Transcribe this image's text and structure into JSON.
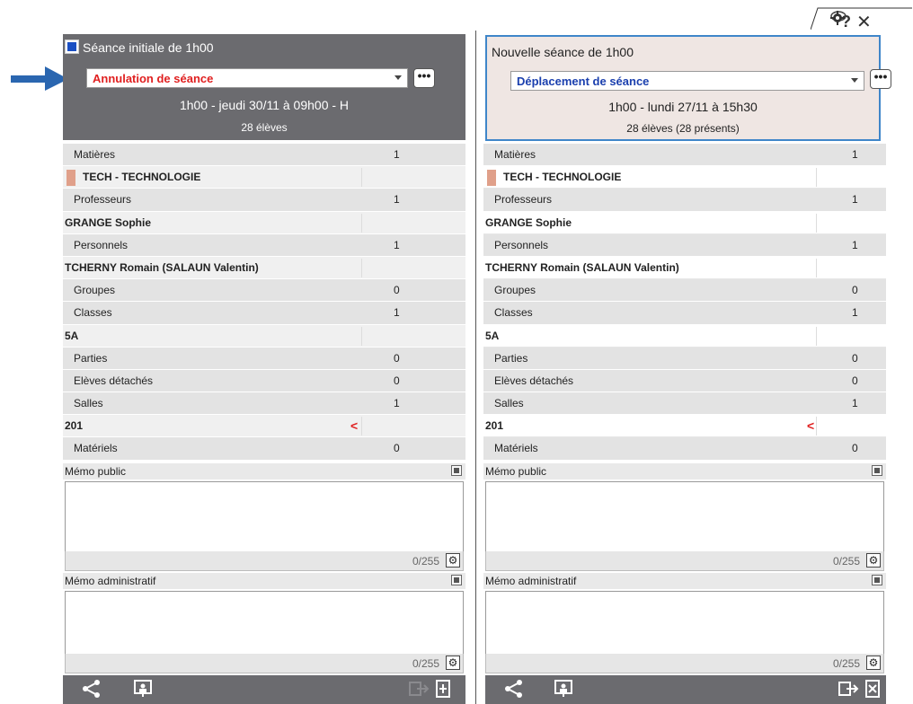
{
  "toolbar": {
    "icons": [
      "eye-icon",
      "gear-icon",
      "help-icon",
      "close-icon"
    ]
  },
  "left": {
    "title": "Séance initiale de 1h00",
    "action_value": "Annulation de séance",
    "more_label": "•••",
    "line1": "1h00  -  jeudi 30/11 à 09h00  -  H",
    "line2": "28 élèves",
    "rows": [
      {
        "type": "cat",
        "label": "Matières",
        "count": "1"
      },
      {
        "type": "item",
        "label": "TECH - TECHNOLOGIE",
        "swatch": true
      },
      {
        "type": "cat",
        "label": "Professeurs",
        "count": "1"
      },
      {
        "type": "item",
        "label": "GRANGE Sophie"
      },
      {
        "type": "cat",
        "label": "Personnels",
        "count": "1"
      },
      {
        "type": "item",
        "label": "TCHERNY Romain (SALAUN Valentin)"
      },
      {
        "type": "cat",
        "label": "Groupes",
        "count": "0"
      },
      {
        "type": "cat",
        "label": "Classes",
        "count": "1"
      },
      {
        "type": "item",
        "label": "5A"
      },
      {
        "type": "cat",
        "label": "Parties",
        "count": "0"
      },
      {
        "type": "cat",
        "label": "Elèves détachés",
        "count": "0"
      },
      {
        "type": "cat",
        "label": "Salles",
        "count": "1"
      },
      {
        "type": "item",
        "label": "201",
        "mark": "<"
      },
      {
        "type": "cat",
        "label": "Matériels",
        "count": "0"
      }
    ],
    "memo_public": {
      "label": "Mémo public",
      "counter": "0/255"
    },
    "memo_admin": {
      "label": "Mémo administratif",
      "counter": "0/255"
    }
  },
  "right": {
    "title": "Nouvelle séance de 1h00",
    "action_value": "Déplacement de séance",
    "more_label": "•••",
    "line1": "1h00  -  lundi 27/11 à 15h30",
    "line2": "28 élèves (28 présents)",
    "rows": [
      {
        "type": "cat",
        "label": "Matières",
        "count": "1"
      },
      {
        "type": "item",
        "label": "TECH - TECHNOLOGIE",
        "swatch": true
      },
      {
        "type": "cat",
        "label": "Professeurs",
        "count": "1"
      },
      {
        "type": "item",
        "label": "GRANGE Sophie"
      },
      {
        "type": "cat",
        "label": "Personnels",
        "count": "1"
      },
      {
        "type": "item",
        "label": "TCHERNY Romain (SALAUN Valentin)"
      },
      {
        "type": "cat",
        "label": "Groupes",
        "count": "0"
      },
      {
        "type": "cat",
        "label": "Classes",
        "count": "1"
      },
      {
        "type": "item",
        "label": "5A"
      },
      {
        "type": "cat",
        "label": "Parties",
        "count": "0"
      },
      {
        "type": "cat",
        "label": "Elèves détachés",
        "count": "0"
      },
      {
        "type": "cat",
        "label": "Salles",
        "count": "1"
      },
      {
        "type": "item",
        "label": "201",
        "mark": "<"
      },
      {
        "type": "cat",
        "label": "Matériels",
        "count": "0"
      }
    ],
    "memo_public": {
      "label": "Mémo public",
      "counter": "0/255"
    },
    "memo_admin": {
      "label": "Mémo administratif",
      "counter": "0/255"
    }
  },
  "colors": {
    "header_gray": "#6b6b6f",
    "accent_blue": "#3f86c9",
    "cancel_red": "#e02020",
    "move_blue": "#1a3fae",
    "swatch": "#e0a08a"
  }
}
